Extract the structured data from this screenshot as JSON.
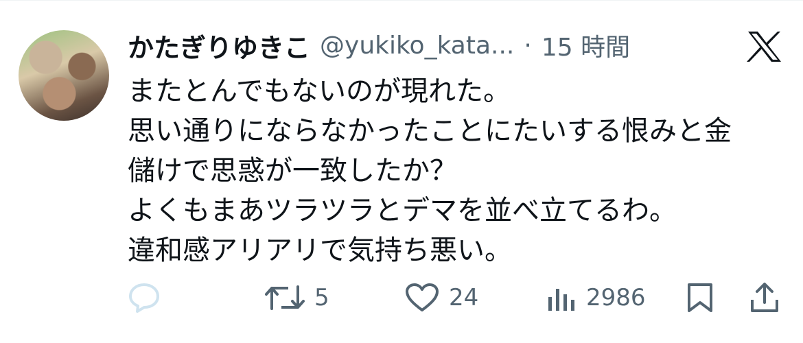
{
  "tweet": {
    "display_name": "かたぎりゆきこ",
    "handle": "@yukiko_kata...",
    "separator": "·",
    "time": "15 時間",
    "lines": [
      "またとんでもないのが現れた。",
      "思い通りにならなかったことにたいする恨みと金",
      "儲けで思惑が一致したか？",
      "よくもまあツラツラとデマを並べ立てるわ。",
      "違和感アリアリで気持ち悪い。"
    ]
  },
  "actions": {
    "retweets": "5",
    "likes": "24",
    "views": "2986"
  },
  "icons": {
    "reply": "reply-icon",
    "retweet": "retweet-icon",
    "like": "heart-icon",
    "views": "views-icon",
    "bookmark": "bookmark-icon",
    "share": "share-icon",
    "brand": "x-logo-icon"
  },
  "colors": {
    "text": "#0f1419",
    "secondary": "#536471",
    "reply_icon": "#cfe3ef"
  }
}
